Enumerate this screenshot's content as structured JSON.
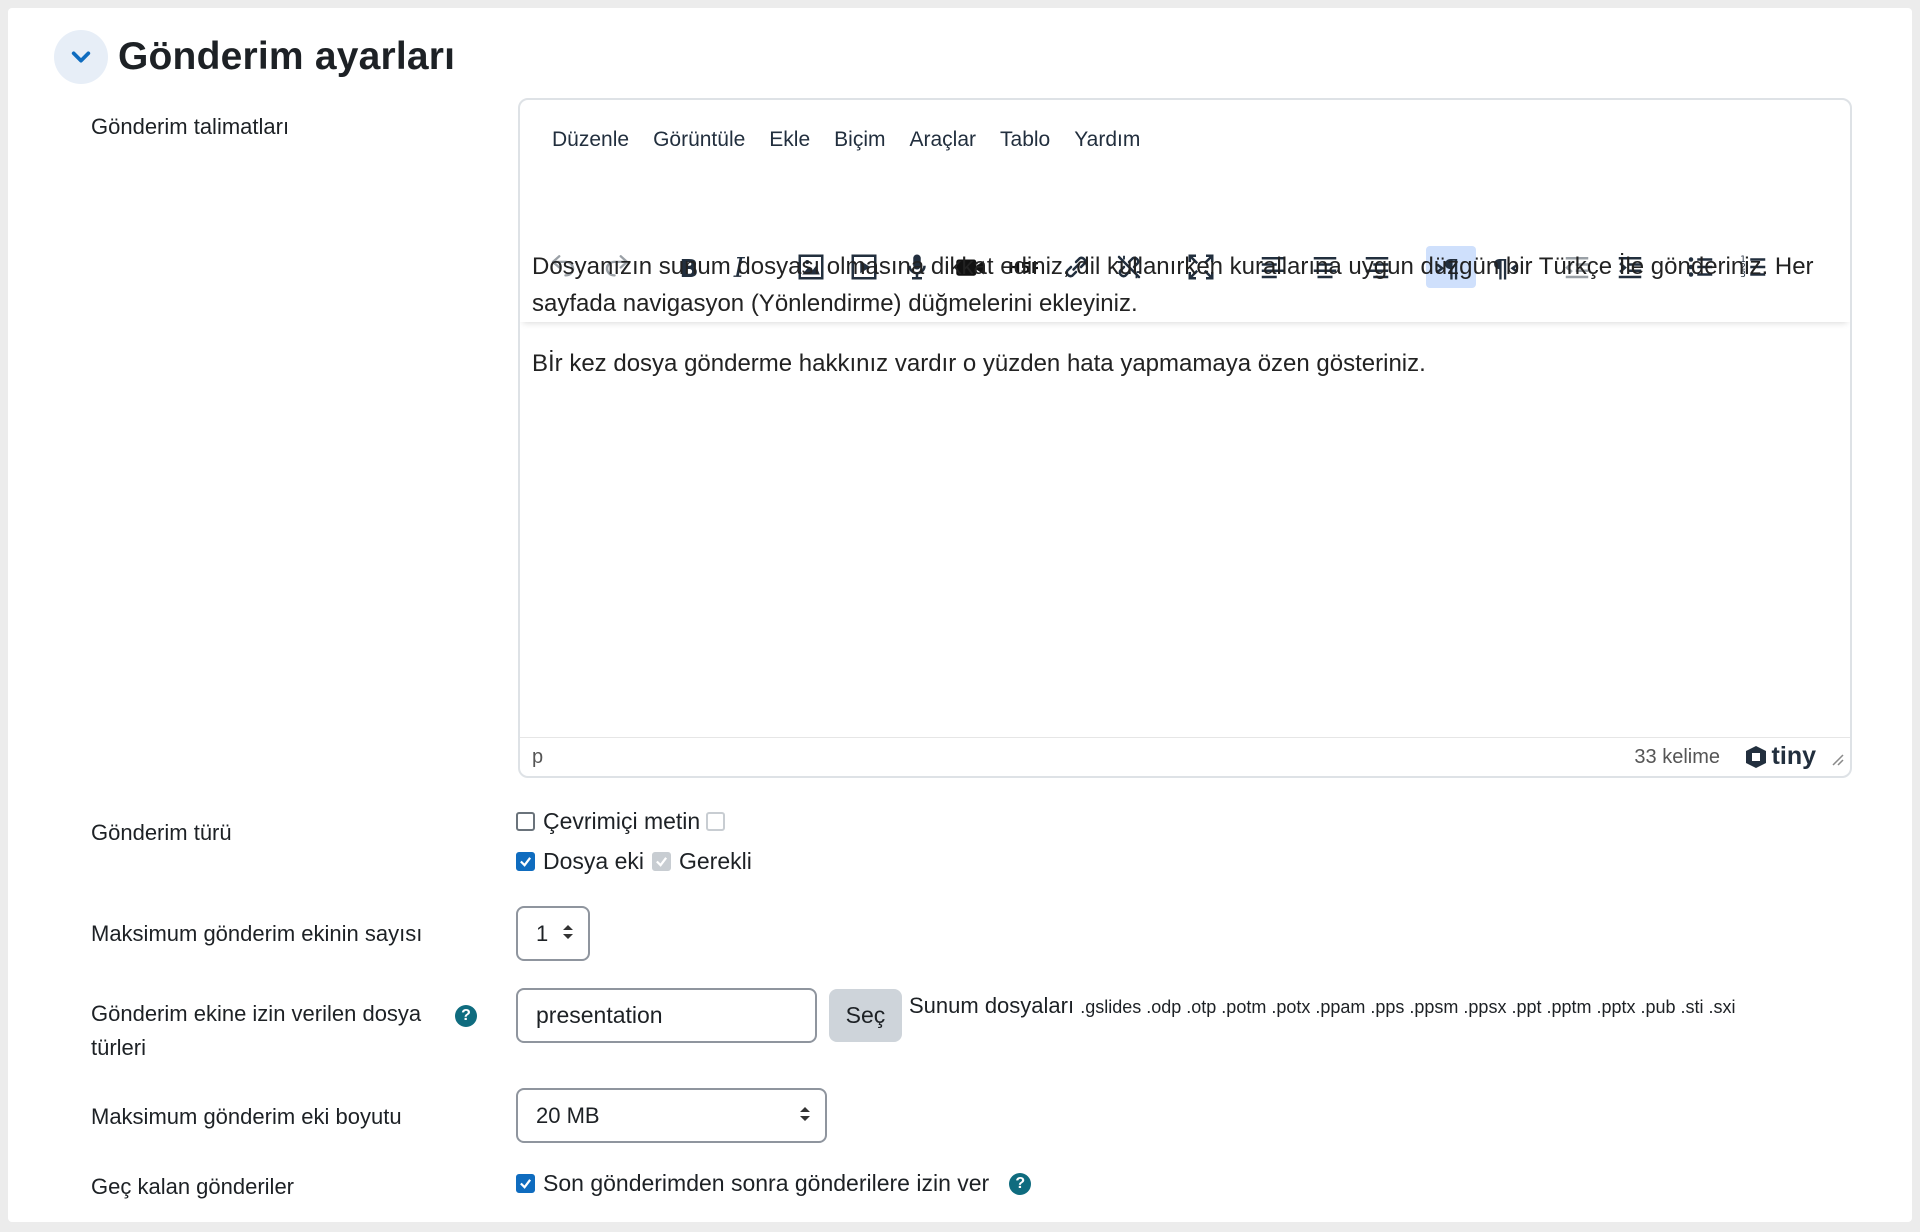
{
  "section": {
    "title": "Gönderim ayarları"
  },
  "fields": {
    "instructions_label": "Gönderim talimatları",
    "type_label": "Gönderim türü",
    "max_files_label": "Maksimum gönderim ekinin sayısı",
    "filetypes_label_line1": "Gönderim ekine izin verilen dosya",
    "filetypes_label_line2": "türleri",
    "max_size_label": "Maksimum gönderim eki boyutu",
    "late_label": "Geç kalan gönderiler"
  },
  "editor": {
    "menu": [
      "Düzenle",
      "Görüntüle",
      "Ekle",
      "Biçim",
      "Araçlar",
      "Tablo",
      "Yardım"
    ],
    "content": {
      "p1": "Dosyanızın sunum dosyası olmasına dikkat ediniz, dil kullanırken kurallarına uygun düzgün bir Türkçe İle gönderiniz. Her sayfada navigasyon (Yönlendirme) düğmelerini ekleyiniz.",
      "p2": "Bİr kez dosya gönderme hakkınız vardır o yüzden hata yapmamaya özen gösteriniz."
    },
    "status_path": "p",
    "word_count": "33 kelime",
    "brand": "tiny"
  },
  "submission_types": {
    "online_text": "Çevrimiçi metin",
    "file": "Dosya eki",
    "required": "Gerekli"
  },
  "max_files": {
    "value": "1"
  },
  "filetypes": {
    "input_value": "presentation",
    "choose_button": "Seç",
    "group_name": "Sunum dosyaları",
    "extensions": ".gslides .odp .otp .potm .potx .ppam .pps .ppsm .ppsx .ppt .pptm .pptx .pub .sti .sxi"
  },
  "max_size": {
    "value": "20 MB"
  },
  "late": {
    "checkbox_label": "Son gönderimden sonra gönderilere izin ver"
  },
  "colors": {
    "accent": "#0f6cbf",
    "help": "#0f6c7f",
    "active_tool": "#cfe0fc"
  }
}
